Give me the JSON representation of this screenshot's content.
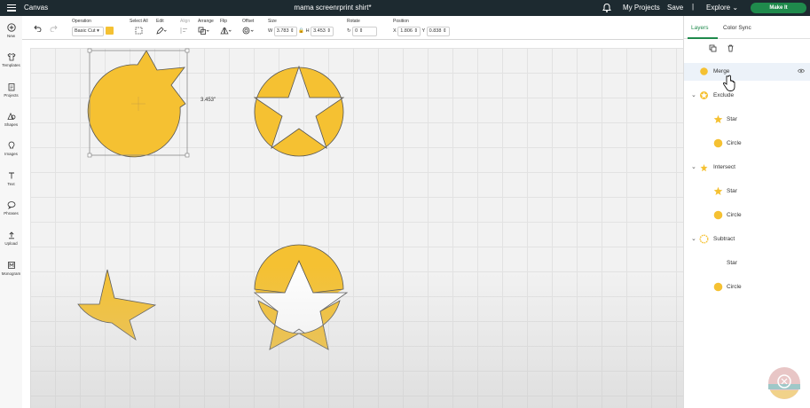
{
  "topbar": {
    "app_title": "Canvas",
    "doc_title": "mama screenrprint shirt*",
    "my_projects": "My Projects",
    "save": "Save",
    "separator": "|",
    "explore": "Explore",
    "make_it": "Make It"
  },
  "toolbar": {
    "operation_label": "Operation",
    "operation_value": "Basic Cut",
    "select_all_label": "Select All",
    "edit_label": "Edit",
    "align_label": "Align",
    "arrange_label": "Arrange",
    "flip_label": "Flip",
    "offset_label": "Offset",
    "size_label": "Size",
    "w_label": "W",
    "w_value": "3.783",
    "h_label": "H",
    "h_value": "3.453",
    "rotate_label": "Rotate",
    "rotate_value": "0",
    "position_label": "Position",
    "x_label": "X",
    "x_value": "1.806",
    "y_label": "Y",
    "y_value": "0.838",
    "accent_color": "#f5c132"
  },
  "nav": [
    {
      "label": "New",
      "icon": "plus-circle-icon"
    },
    {
      "label": "Templates",
      "icon": "shirt-icon"
    },
    {
      "label": "Projects",
      "icon": "clipboard-icon"
    },
    {
      "label": "Shapes",
      "icon": "shapes-icon"
    },
    {
      "label": "Images",
      "icon": "bulb-icon"
    },
    {
      "label": "Text",
      "icon": "text-icon"
    },
    {
      "label": "Phrases",
      "icon": "speech-bubble-icon"
    },
    {
      "label": "Upload",
      "icon": "upload-icon"
    },
    {
      "label": "Monogram",
      "icon": "monogram-icon"
    }
  ],
  "canvas": {
    "dimension_label": "3.453\"",
    "shape_color": "#f5c132"
  },
  "panel": {
    "tabs": [
      "Layers",
      "Color Sync"
    ],
    "layers": [
      {
        "name": "Merge",
        "indent": 0,
        "icon": "merge-icon",
        "selected": true
      },
      {
        "name": "Exclude",
        "indent": 0,
        "icon": "exclude-icon",
        "group": true
      },
      {
        "name": "Star",
        "indent": 1,
        "icon": "star-icon"
      },
      {
        "name": "Circle",
        "indent": 1,
        "icon": "circle-icon"
      },
      {
        "name": "Intersect",
        "indent": 0,
        "icon": "intersect-icon",
        "group": true
      },
      {
        "name": "Star",
        "indent": 1,
        "icon": "star-icon"
      },
      {
        "name": "Circle",
        "indent": 1,
        "icon": "circle-icon"
      },
      {
        "name": "Subtract",
        "indent": 0,
        "icon": "subtract-icon",
        "group": true
      },
      {
        "name": "Star",
        "indent": 1,
        "icon": "star-icon"
      },
      {
        "name": "Circle",
        "indent": 1,
        "icon": "circle-icon"
      }
    ]
  }
}
